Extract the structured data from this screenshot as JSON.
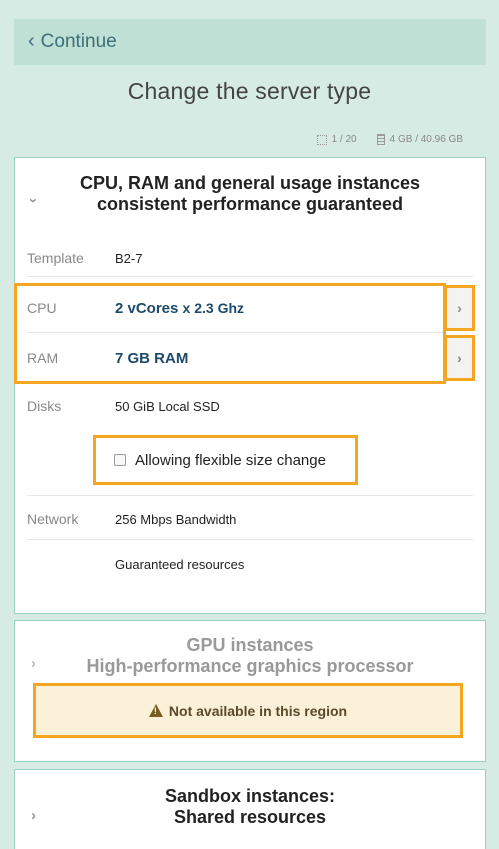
{
  "nav": {
    "continue_label": "Continue"
  },
  "page": {
    "title": "Change the server type"
  },
  "quota": {
    "instances": "1 / 20",
    "memory": "4 GB / 40.96 GB"
  },
  "general_card": {
    "title_line1": "CPU, RAM and general usage instances",
    "title_line2": "consistent performance guaranteed",
    "template_label": "Template",
    "template_value": "B2-7",
    "cpu_label": "CPU",
    "cpu_value": "2 vCores",
    "cpu_freq": "x 2.3 Ghz",
    "ram_label": "RAM",
    "ram_value": "7 GB RAM",
    "disks_label": "Disks",
    "disks_value": "50 GiB Local SSD",
    "flexible_label": "Allowing flexible size change",
    "flexible_checked": false,
    "network_label": "Network",
    "network_value": "256 Mbps Bandwidth",
    "guaranteed_value": "Guaranteed resources"
  },
  "gpu_card": {
    "title_line1": "GPU instances",
    "title_line2": "High-performance graphics processor",
    "notice": "Not available in this region"
  },
  "sandbox_card": {
    "title_line1": "Sandbox instances:",
    "title_line2": "Shared resources"
  },
  "colors": {
    "background": "#d6ebe4",
    "highlight": "#f4a623",
    "value_blue": "#1e4a6a"
  }
}
